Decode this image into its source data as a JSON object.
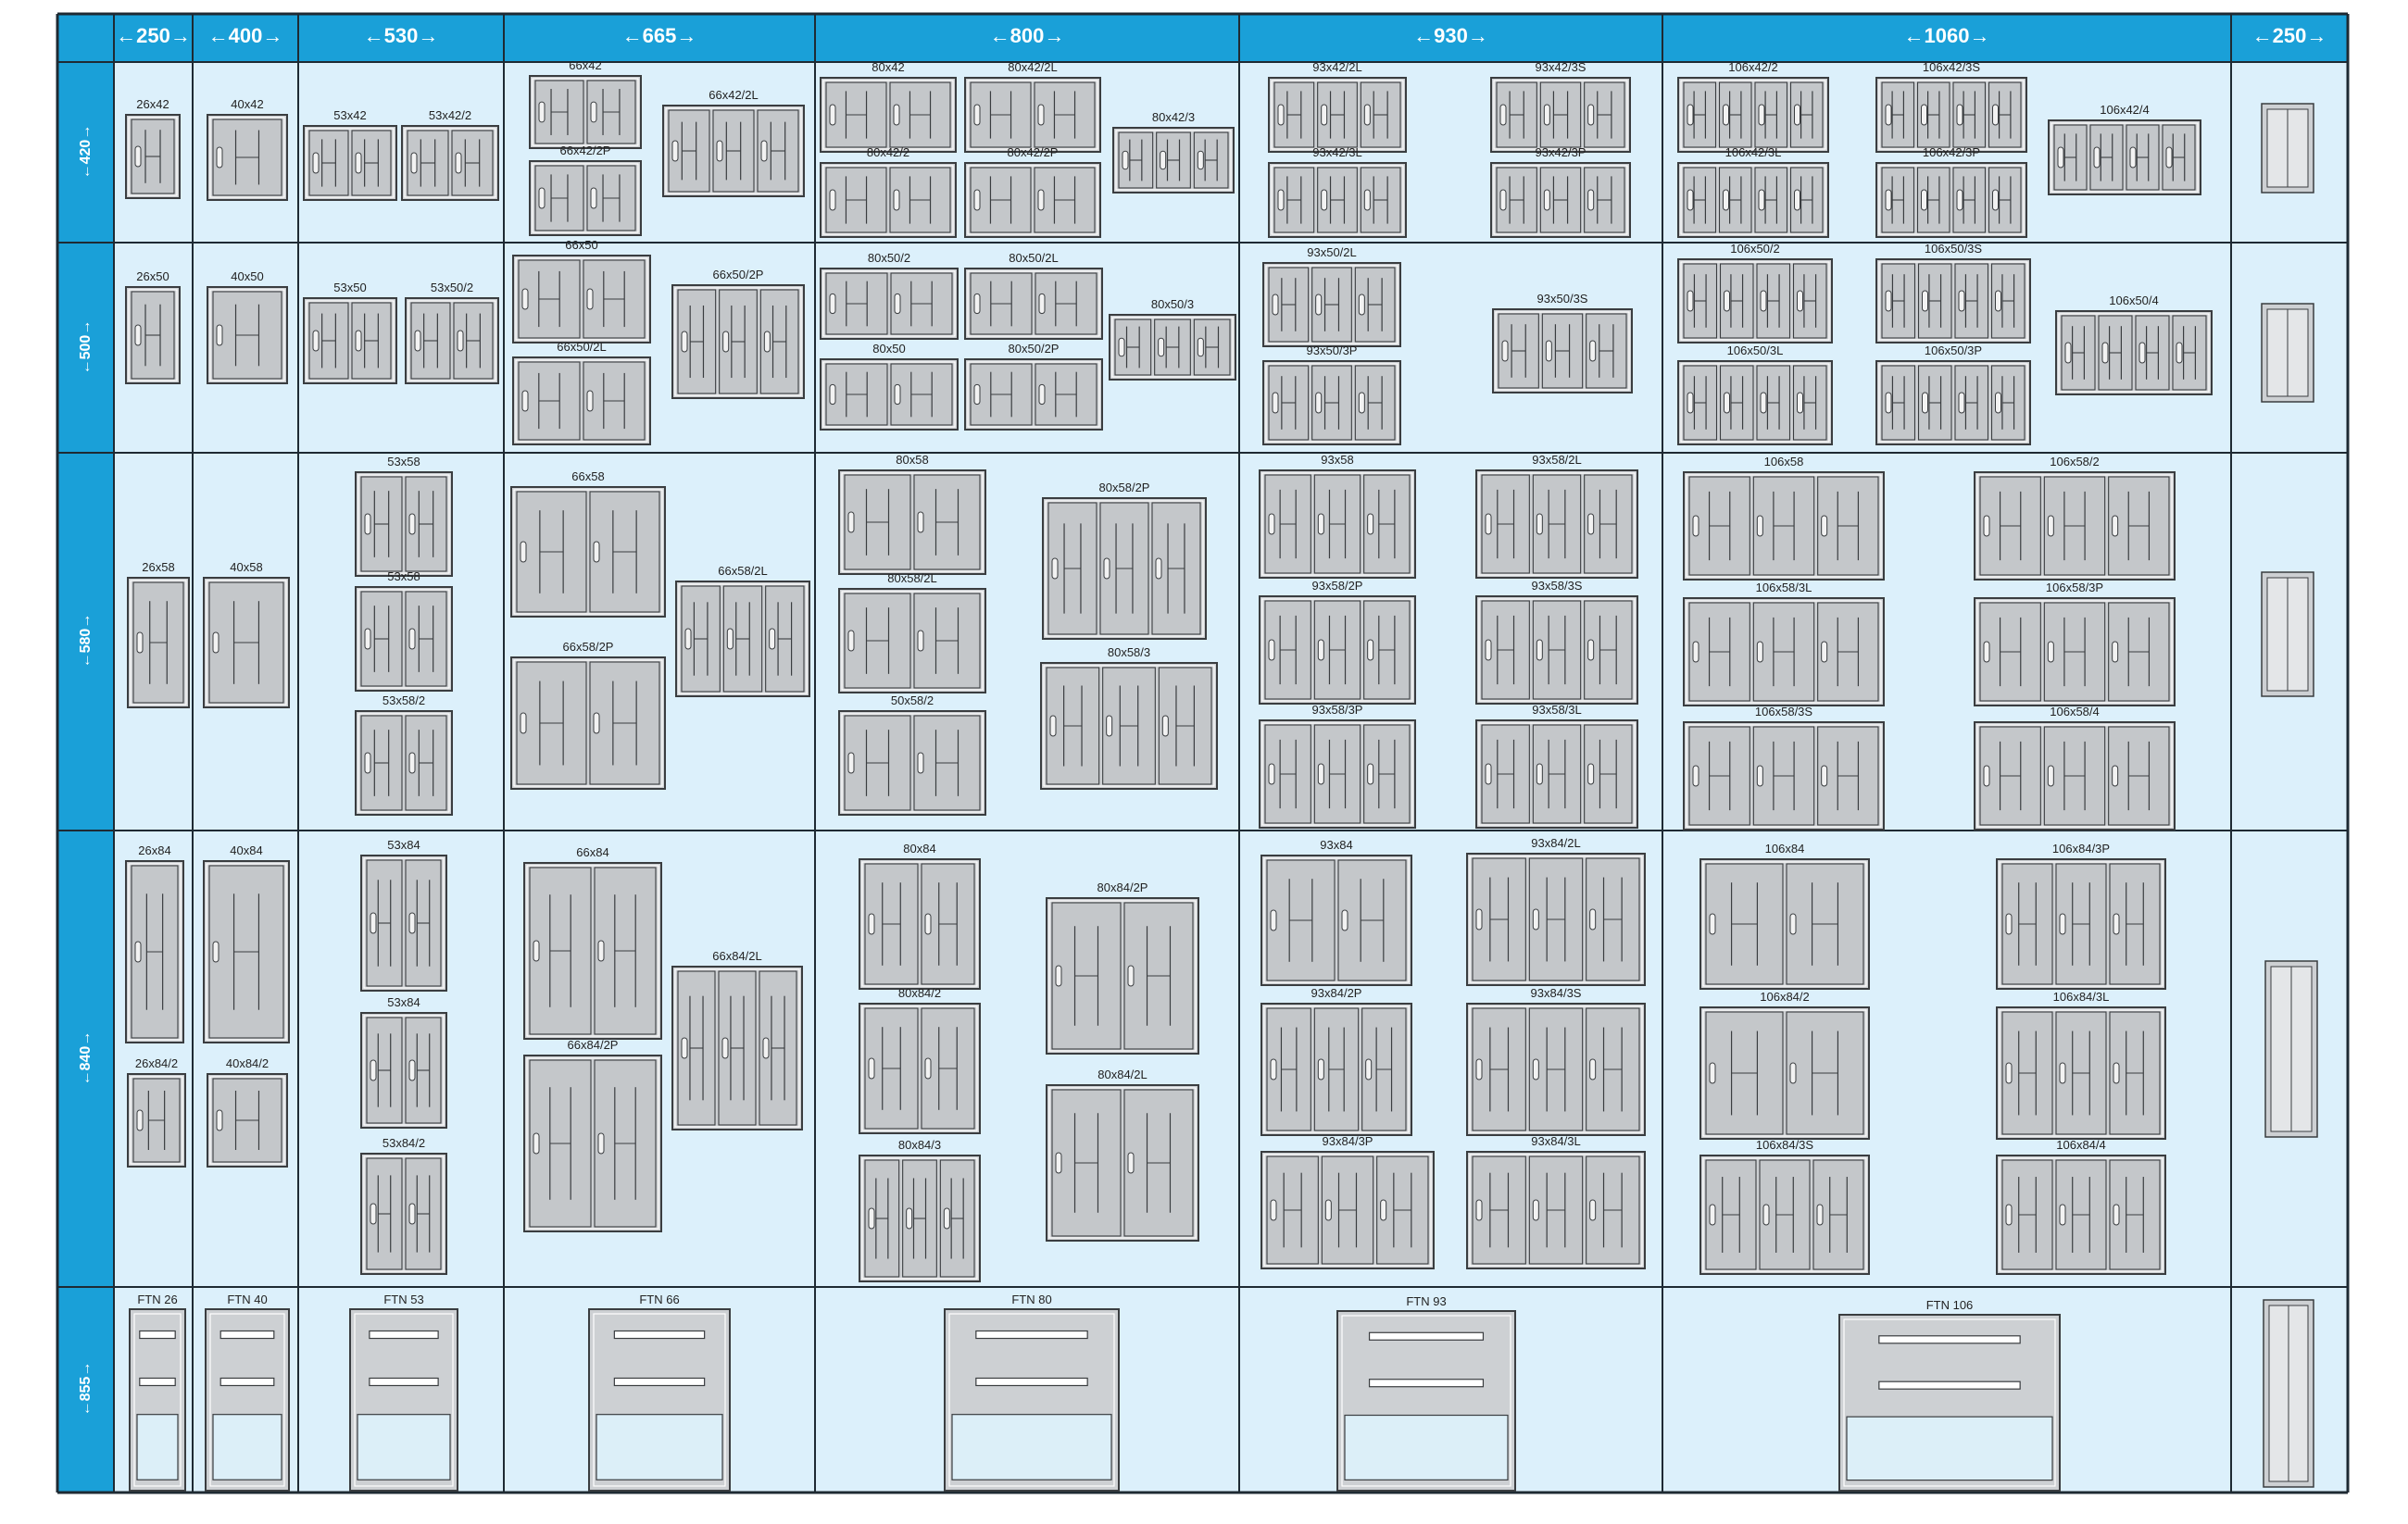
{
  "colors": {
    "header": "#1aa0d8",
    "cell": "#dcf0fb",
    "grid": "#1e2a33",
    "door": "#cdd0d3",
    "door_stroke": "#3a3d40",
    "page": "#ffffff"
  },
  "widths": [
    "←250→",
    "←400→",
    "←530→",
    "←665→",
    "←800→",
    "←930→",
    "←1060→",
    "←250→"
  ],
  "heights": [
    "←420→",
    "←500→",
    "←580→",
    "←840→",
    "←855→"
  ],
  "labels": {
    "r0": [
      "26x42",
      "40x42",
      "53x42",
      "53x42/2",
      "66x42",
      "66x42/2L",
      "66x42/2P",
      "80x42",
      "80x42/2L",
      "80x42/3",
      "80x42/2",
      "80x42/2P",
      "93x42/2L",
      "93x42/3S",
      "93x42/3L",
      "93x42/3P",
      "106x42/2",
      "106x42/3S",
      "106x42/4",
      "106x42/3L",
      "106x42/3P"
    ],
    "r1": [
      "26x50",
      "40x50",
      "53x50",
      "53x50/2",
      "66x50",
      "66x50/2P",
      "66x50/2L",
      "80x50/2",
      "80x50/2L",
      "80x50/3",
      "80x50",
      "80x50/2P",
      "93x50/2L",
      "93x50/3S",
      "93x50/3P",
      "106x50/2",
      "106x50/3S",
      "106x50/4",
      "106x50/3L",
      "106x50/3P"
    ],
    "r2": [
      "26x58",
      "40x58",
      "53x58",
      "53x58",
      "53x58/2",
      "66x58",
      "66x58/2L",
      "66x58/2P",
      "80x58",
      "80x58/2P",
      "80x58/2L",
      "80x58/3",
      "50x58/2",
      "93x58",
      "93x58/2L",
      "93x58/2P",
      "93x58/3S",
      "93x58/3P",
      "93x58/3L",
      "106x58",
      "106x58/2",
      "106x58/3L",
      "106x58/3P",
      "106x58/3S",
      "106x58/4"
    ],
    "r3": [
      "26x84",
      "40x84",
      "26x84/2",
      "40x84/2",
      "53x84",
      "53x84",
      "53x84/2",
      "66x84",
      "66x84/2L",
      "66x84/2P",
      "80x84",
      "80x84/2P",
      "80x84/2",
      "80x84/2L",
      "80x84/3",
      "93x84",
      "93x84/2L",
      "93x84/2P",
      "93x84/3S",
      "93x84/3P",
      "93x84/3L",
      "106x84",
      "106x84/3P",
      "106x84/2",
      "106x84/3L",
      "106x84/3S",
      "106x84/4"
    ],
    "r4": [
      "FTN 26",
      "FTN 40",
      "FTN 53",
      "FTN 66",
      "FTN 80",
      "FTN 93",
      "FTN 106"
    ]
  }
}
